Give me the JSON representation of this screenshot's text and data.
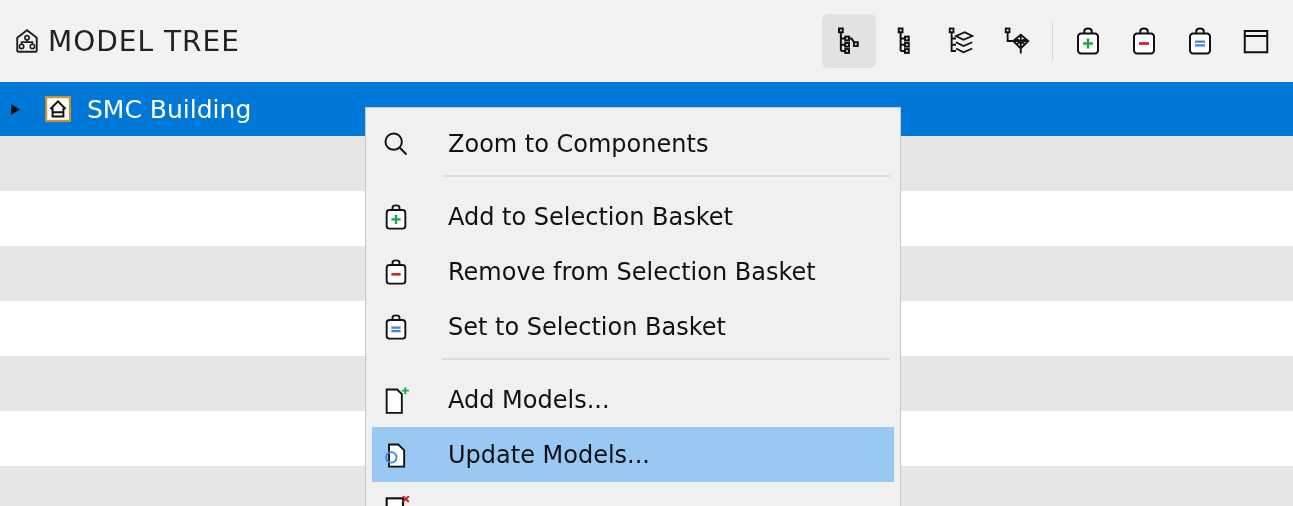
{
  "panel": {
    "title": "MODEL TREE"
  },
  "toolbar": [
    {
      "kind": "tool",
      "selected": true
    },
    {
      "kind": "tool",
      "selected": false
    },
    {
      "kind": "tool",
      "selected": false
    },
    {
      "kind": "tool",
      "selected": false
    },
    {
      "kind": "separator"
    },
    {
      "kind": "tool",
      "selected": false
    },
    {
      "kind": "tool",
      "selected": false
    },
    {
      "kind": "tool",
      "selected": false
    },
    {
      "kind": "tool",
      "selected": false
    }
  ],
  "tree": [
    {
      "label": "SMC Building",
      "selected": true,
      "expanded": false
    }
  ],
  "context_menu": [
    {
      "kind": "item",
      "label": "Zoom to Components",
      "selected": false
    },
    {
      "kind": "separator"
    },
    {
      "kind": "item",
      "label": "Add to Selection Basket",
      "selected": false
    },
    {
      "kind": "item",
      "label": "Remove from Selection Basket",
      "selected": false
    },
    {
      "kind": "item",
      "label": "Set to Selection Basket",
      "selected": false
    },
    {
      "kind": "separator"
    },
    {
      "kind": "item",
      "label": "Add Models...",
      "selected": false
    },
    {
      "kind": "item",
      "label": "Update Models...",
      "selected": true
    },
    {
      "kind": "item",
      "selected": false
    }
  ]
}
